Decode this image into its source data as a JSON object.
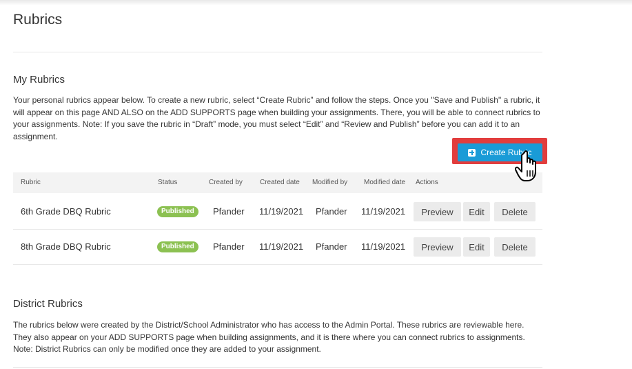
{
  "page": {
    "title": "Rubrics"
  },
  "my_rubrics": {
    "title": "My Rubrics",
    "description": "Your personal rubrics appear below. To create a new rubric, select “Create Rubric” and follow the steps. Once you \"Save and Publish\" a rubric, it will appear on this page AND ALSO on the ADD SUPPORTS page when building your assignments. There, you will be able to connect rubrics to your assignments. Note: If you save the rubric in “Draft” mode, you must select “Edit” and “Review and Publish” before you can add it to an assignment.",
    "create_button_label": "Create Rubric",
    "columns": [
      "Rubric",
      "Status",
      "Created by",
      "Created date",
      "Modified by",
      "Modified date",
      "Actions"
    ],
    "rows": [
      {
        "name": "6th Grade DBQ Rubric",
        "status": "Published",
        "created_by": "Pfander",
        "created_date": "11/19/2021",
        "modified_by": "Pfander",
        "modified_date": "11/19/2021",
        "actions": [
          "Preview",
          "Edit",
          "Delete"
        ]
      },
      {
        "name": "8th Grade DBQ Rubric",
        "status": "Published",
        "created_by": "Pfander",
        "created_date": "11/19/2021",
        "modified_by": "Pfander",
        "modified_date": "11/19/2021",
        "actions": [
          "Preview",
          "Edit",
          "Delete"
        ]
      }
    ]
  },
  "district_rubrics": {
    "title": "District Rubrics",
    "description": "The rubrics below were created by the District/School Administrator who has access to the Admin Portal. These rubrics are reviewable here. They also appear on your ADD SUPPORTS page when building assignments, and it is there where you can connect rubrics to assignments. Note: District Rubrics can only be modified once they are added to your assignment."
  },
  "colors": {
    "accent": "#1a9bd7",
    "highlight": "#e23d3d",
    "published_badge": "#8cc152",
    "header_bg": "#f3f3f3",
    "action_bg": "#ebebeb"
  },
  "icons": {
    "create": "plus-square-icon",
    "cursor": "hand-pointer-icon"
  }
}
